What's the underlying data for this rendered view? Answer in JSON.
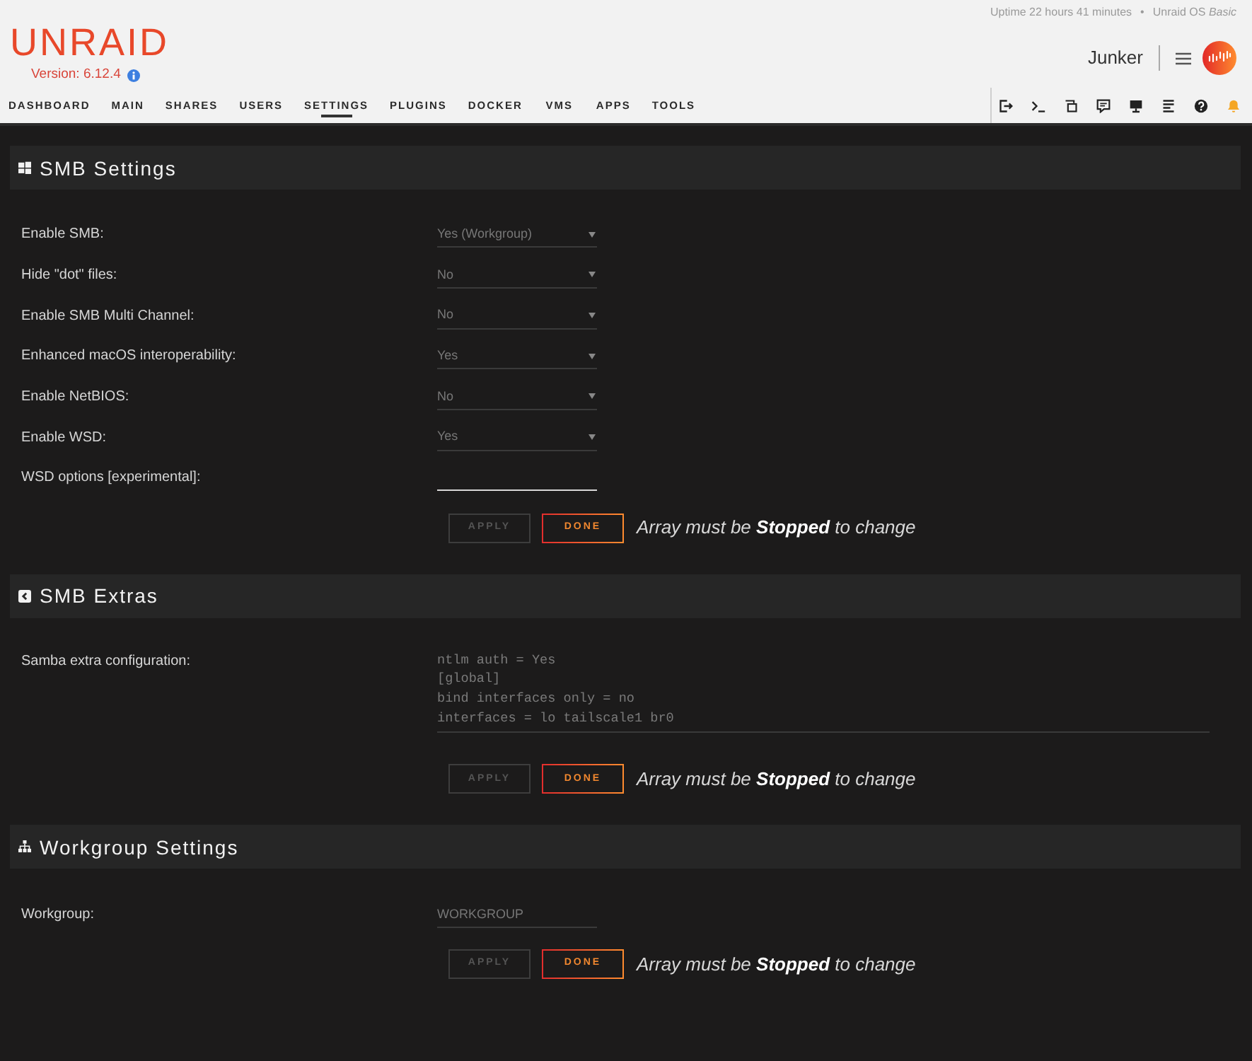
{
  "header": {
    "logo": "UNRAID",
    "version": "Version: 6.12.4",
    "uptime": "Uptime 22 hours 41 minutes",
    "separator": "•",
    "license": "Unraid OS *Basic*",
    "server_name": "Junker"
  },
  "nav": [
    {
      "label": "DASHBOARD",
      "selected": false
    },
    {
      "label": "MAIN",
      "selected": false
    },
    {
      "label": "SHARES",
      "selected": false
    },
    {
      "label": "USERS",
      "selected": false
    },
    {
      "label": "SETTINGS",
      "selected": true
    },
    {
      "label": "PLUGINS",
      "selected": false
    },
    {
      "label": "DOCKER",
      "selected": false
    },
    {
      "label": "VMS",
      "selected": false
    },
    {
      "label": "APPS",
      "selected": false
    },
    {
      "label": "TOOLS",
      "selected": false
    }
  ],
  "sections": [
    {
      "title": "SMB Settings",
      "fields": [
        {
          "kind": "select",
          "label": "Enable SMB:",
          "value": "Yes (Workgroup)",
          "disabled": true
        },
        {
          "kind": "select",
          "label": "Hide \"dot\" files:",
          "value": "No",
          "disabled": true
        },
        {
          "kind": "select",
          "label": "Enable SMB Multi Channel:",
          "value": "No",
          "disabled": true
        },
        {
          "kind": "select",
          "label": "Enhanced macOS interoperability:",
          "value": "Yes",
          "disabled": true
        },
        {
          "kind": "select",
          "label": "Enable NetBIOS:",
          "value": "No",
          "disabled": true
        },
        {
          "kind": "select",
          "label": "Enable WSD:",
          "value": "Yes",
          "disabled": true
        },
        {
          "kind": "input",
          "label": "WSD options [experimental]:",
          "disabled": false
        }
      ],
      "buttons": [
        {
          "label": "APPLY",
          "disabled": true
        },
        {
          "label": "DONE",
          "disabled": false
        }
      ],
      "note": "Array must be **Stopped** to change"
    },
    {
      "title": "SMB Extras",
      "fields": [
        {
          "kind": "textarea",
          "label": "Samba extra configuration:",
          "lines": [
            "ntlm auth = Yes",
            "[global]",
            "bind interfaces only = no",
            "interfaces = lo tailscale1 br0"
          ],
          "disabled": true
        }
      ],
      "buttons": [
        {
          "label": "APPLY",
          "disabled": true
        },
        {
          "label": "DONE",
          "disabled": false
        }
      ],
      "note": "Array must be **Stopped** to change"
    },
    {
      "title": "Workgroup Settings",
      "fields": [
        {
          "kind": "input",
          "label": "Workgroup:",
          "value": "WORKGROUP",
          "disabled": true
        }
      ],
      "buttons": [
        {
          "label": "APPLY",
          "disabled": true
        },
        {
          "label": "DONE",
          "disabled": false
        }
      ],
      "note": "Array must be **Stopped** to change"
    }
  ]
}
